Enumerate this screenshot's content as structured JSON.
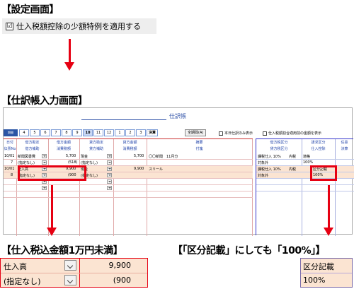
{
  "settings": {
    "title": "【設定画面】",
    "checkbox_checked": true,
    "checkbox_mark": "☑",
    "checkbox_label": "仕入税額控除の少額特例を適用する"
  },
  "journal": {
    "section_title": "【仕訳帳入力画面】",
    "window_title": "仕訳帳",
    "period_label": "期間",
    "months": [
      "4",
      "5",
      "6",
      "7",
      "8",
      "9",
      "10",
      "11",
      "12",
      "1",
      "2",
      "3"
    ],
    "selected_month": "10",
    "settle_label": "決算",
    "full_display_button": "全期間(A)",
    "today_only_label": "本日仕訳のみ表示",
    "display_tax_label": "仕入税額割合適用前の金額を表示",
    "headers_left_top": [
      "日付",
      "借方勘定",
      "借方金額",
      "貸方勘定",
      "貸方金額",
      "摘要"
    ],
    "headers_left_bottom": [
      "伝票No",
      "借方補助",
      "消費税額",
      "貸方補助",
      "消費税額",
      "付箋"
    ],
    "headers_right_top": [
      "借方税区分",
      "請求区分",
      "任意"
    ],
    "headers_right_bottom": [
      "貸方税区分",
      "仕入控除",
      "決算"
    ],
    "rows": [
      {
        "date": "10/01",
        "debit": "新聞図書費",
        "amount": "5,700",
        "credit": "現金",
        "credit_amount": "5,700",
        "memo": "〇〇新聞　11月分",
        "tax_class": "課税仕入 10%",
        "tax_type": "内税",
        "invoice": "適格"
      },
      {
        "no": "7",
        "debit_sub": "(指定なし)",
        "tax": "(518)",
        "credit_sub": "(指定なし)",
        "credit_tax": "",
        "tax_class2": "対象外",
        "deduction": "100%"
      },
      {
        "date": "10/01",
        "debit": "仕入高",
        "amount": "9,900",
        "credit": "現金",
        "credit_amount": "9,900",
        "memo": "スリール",
        "tax_class": "課税仕入 10%",
        "tax_type": "内税",
        "invoice": "区分記載"
      },
      {
        "no": "8",
        "debit_sub": "(指定なし)",
        "tax": "(900",
        "credit_sub": "(指定なし)",
        "credit_tax": "",
        "tax_class2": "対象外",
        "deduction": "100%"
      }
    ]
  },
  "callout_left": {
    "title": "【仕入税込金額1万円未満】",
    "row1_label": "仕入高",
    "row1_value": "9,900",
    "row2_label": "(指定なし)",
    "row2_value": "(900"
  },
  "callout_right": {
    "title": "【「区分記載」にしても「100%」】",
    "row1": "区分記載",
    "row2": "100%"
  },
  "colors": {
    "accent_red": "#e60012",
    "highlight_row": "#fbe4d2",
    "header_blue": "#2244aa"
  }
}
